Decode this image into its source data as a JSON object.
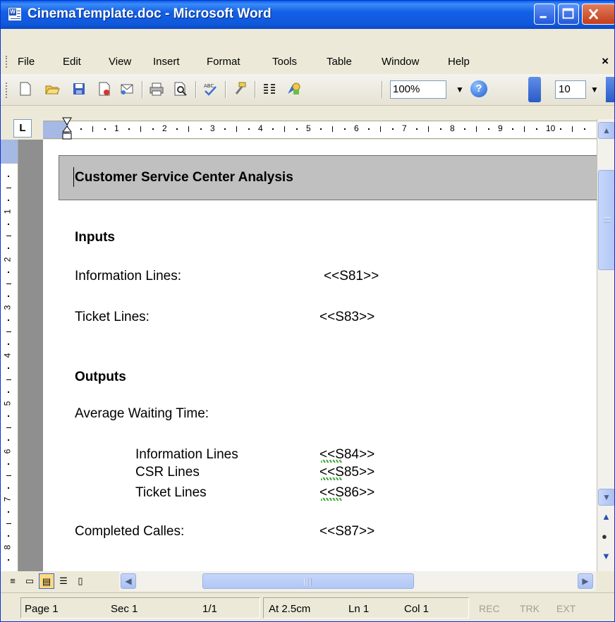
{
  "window": {
    "title": "CinemaTemplate.doc - Microsoft Word"
  },
  "menu": {
    "items": [
      "File",
      "Edit",
      "View",
      "Insert",
      "Format",
      "Tools",
      "Table",
      "Window",
      "Help"
    ],
    "close_glyph": "×"
  },
  "toolbar": {
    "zoom": "100%",
    "font_size": "10",
    "help_glyph": "?",
    "dropdown_glyph": "▼",
    "icons": [
      "new-document-icon",
      "open-folder-icon",
      "save-icon",
      "permission-icon",
      "print-icon",
      "print-preview-icon",
      "spelling-icon",
      "format-painter-icon",
      "columns-icon",
      "drawing-icon"
    ]
  },
  "ruler": {
    "tab_selector": "L",
    "numbers": [
      "1",
      "2",
      "3",
      "4",
      "5",
      "6",
      "7",
      "8",
      "9",
      "10"
    ],
    "vnumbers": [
      "1",
      "2",
      "3",
      "4",
      "5",
      "6",
      "7",
      "8"
    ]
  },
  "document": {
    "heading": "Customer Service Center Analysis",
    "inputs_heading": "Inputs",
    "info_lines_label": "Information Lines:",
    "info_lines_value": "<<S81>>",
    "ticket_lines_label": "Ticket Lines:",
    "ticket_lines_value": "<<S83>>",
    "outputs_heading": "Outputs",
    "avg_wait_label": "Average Waiting Time:",
    "out_info_label": "Information Lines",
    "out_info_value": "<<S84>>",
    "out_csr_label": "CSR Lines",
    "out_csr_value": "<<S85>>",
    "out_ticket_label": "Ticket Lines",
    "out_ticket_value": "<<S86>>",
    "completed_label": "Completed Calles:",
    "completed_value": "<<S87>>"
  },
  "status": {
    "page": "Page  1",
    "sec": "Sec  1",
    "pages": "1/1",
    "at": "At  2.5cm",
    "ln": "Ln  1",
    "col": "Col  1",
    "rec": "REC",
    "trk": "TRK",
    "ext": "EXT"
  }
}
